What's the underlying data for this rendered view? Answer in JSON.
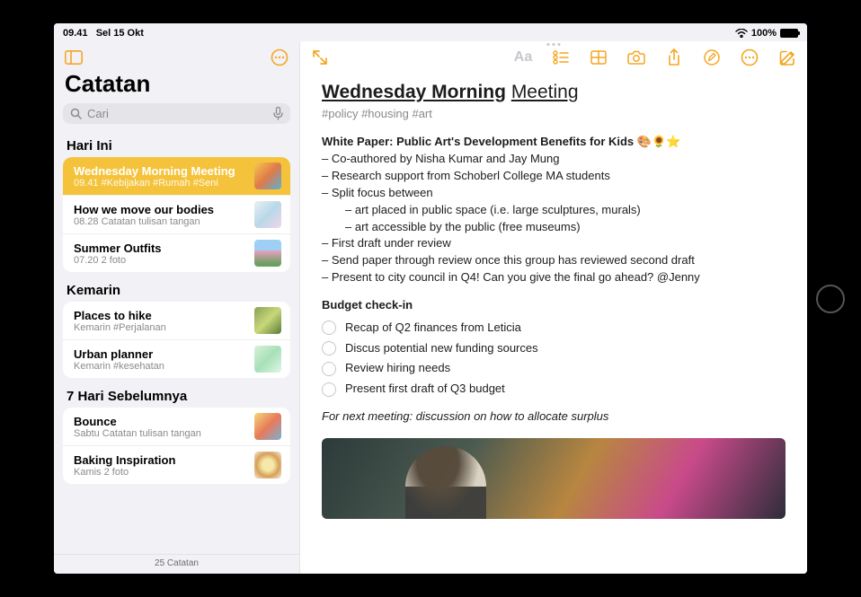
{
  "status_bar": {
    "time": "09.41",
    "date": "Sel 15 Okt",
    "battery": "100%"
  },
  "sidebar": {
    "title": "Catatan",
    "search_placeholder": "Cari",
    "footer": "25 Catatan",
    "sections": [
      {
        "header": "Hari Ini",
        "items": [
          {
            "title": "Wednesday Morning Meeting",
            "sub": "09.41  #Kebijakan #Rumah #Seni",
            "selected": true,
            "thumb": "linear-gradient(135deg,#f5c94a,#e07a4a,#5ab0d6)"
          },
          {
            "title": "How we move our bodies",
            "sub": "08.28  Catatan tulisan tangan",
            "thumb": "linear-gradient(135deg,#e8f0f5,#b8d8e8,#f0d8e8)"
          },
          {
            "title": "Summer Outfits",
            "sub": "07.20  2 foto",
            "thumb": "linear-gradient(180deg,#9ed0f5 40%,#e8a0c0 40%,#6aa060 90%)"
          }
        ]
      },
      {
        "header": "Kemarin",
        "items": [
          {
            "title": "Places to hike",
            "sub": "Kemarin  #Perjalanan",
            "thumb": "linear-gradient(135deg,#8aa058,#c8d878,#5a7a3a)"
          },
          {
            "title": "Urban planner",
            "sub": "Kemarin  #kesehatan",
            "thumb": "linear-gradient(135deg,#d8f0d8,#a8e0b8,#e0f5e8)"
          }
        ]
      },
      {
        "header": "7 Hari Sebelumnya",
        "items": [
          {
            "title": "Bounce",
            "sub": "Sabtu  Catatan tulisan tangan",
            "thumb": "linear-gradient(135deg,#f5d878,#e87a5a,#7ab0d6)"
          },
          {
            "title": "Baking Inspiration",
            "sub": "Kamis  2 foto",
            "thumb": "radial-gradient(circle,#f5e8a8 30%,#d8a058 60%,#f0f0e8 100%)"
          }
        ]
      }
    ]
  },
  "note": {
    "title_bold": "Wednesday Morning",
    "title_light": "Meeting",
    "tags": "#policy #housing #art",
    "white_paper_heading": "White Paper: Public Art's Development Benefits for Kids 🎨🌻⭐",
    "lines": [
      "– Co-authored by Nisha Kumar and Jay Mung",
      "– Research support from Schoberl College MA students",
      "– Split focus between"
    ],
    "indented": [
      "– art placed in public space (i.e. large sculptures, murals)",
      "– art accessible by the public (free museums)"
    ],
    "lines2": [
      "– First draft under review",
      "– Send paper through review once this group has reviewed second draft",
      "– Present to city council in Q4! Can you give the final go ahead? @Jenny"
    ],
    "budget_heading": "Budget check-in",
    "checklist": [
      "Recap of Q2 finances from Leticia",
      "Discus potential new funding sources",
      "Review hiring needs",
      "Present first draft of Q3 budget"
    ],
    "footer_line": "For next meeting: discussion on how to allocate surplus"
  },
  "toolbar": {
    "aa": "Aa"
  }
}
